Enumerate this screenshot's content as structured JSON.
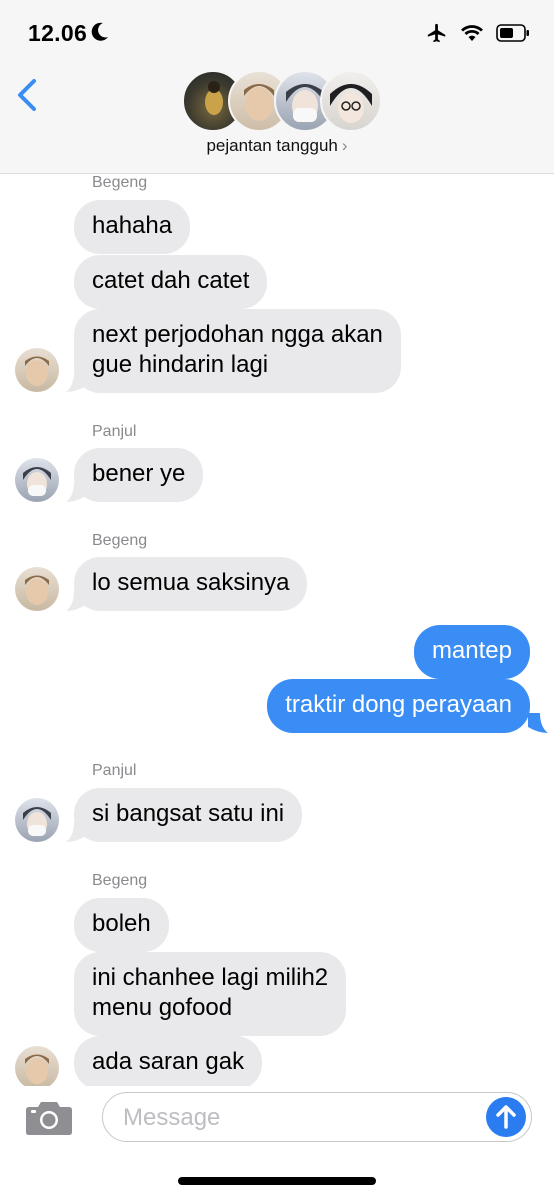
{
  "status_bar": {
    "time": "12.06",
    "icons": [
      "moon-icon",
      "airplane-icon",
      "wifi-icon",
      "battery-icon"
    ]
  },
  "header": {
    "group_name": "pejantan tangguh",
    "chevron": "›",
    "back_icon": "chevron-left-icon",
    "accent_color": "#3a8df5"
  },
  "messages": {
    "sender_begeng": "Begeng",
    "m1": "hahaha",
    "m2": "catet dah catet",
    "m3_line1": "next perjodohan ngga akan",
    "m3_line2": "gue hindarin lagi",
    "sender_panjul": "Panjul",
    "m4": "bener ye",
    "sender_begeng_2": "Begeng",
    "m5": "lo semua saksinya",
    "out1": "mantep",
    "out2": "traktir dong perayaan",
    "sender_panjul_2": "Panjul",
    "m6": "si bangsat satu ini",
    "sender_begeng_3": "Begeng",
    "m7": "boleh",
    "m8_line1": "ini chanhee lagi milih2",
    "m8_line2": "menu gofood",
    "m9": "ada saran gak"
  },
  "input": {
    "placeholder": "Message",
    "camera_icon": "camera-icon",
    "send_icon": "arrow-up-icon"
  }
}
